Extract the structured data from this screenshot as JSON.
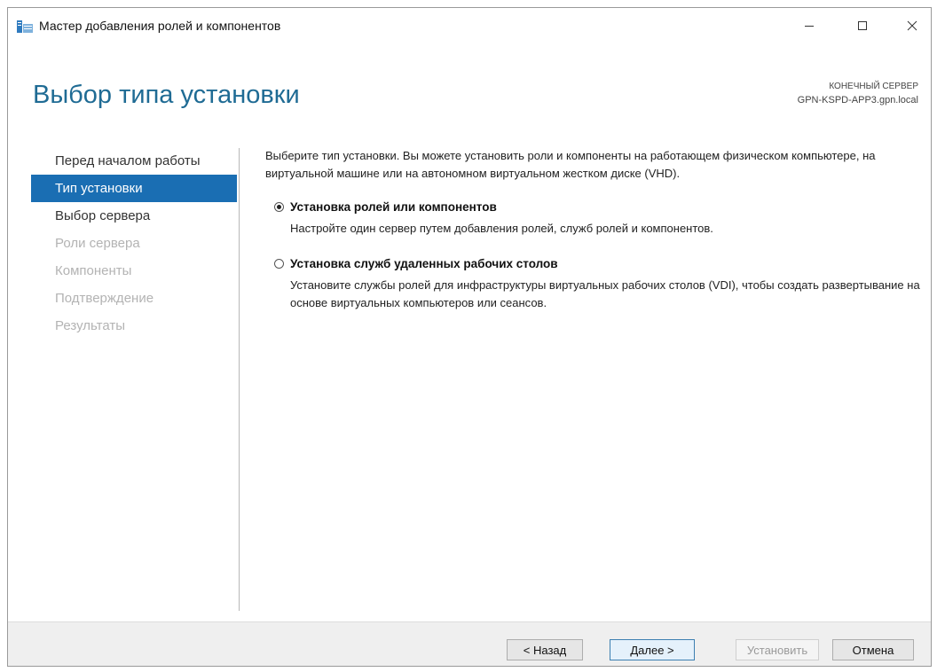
{
  "window": {
    "title": "Мастер добавления ролей и компонентов"
  },
  "header": {
    "page_title": "Выбор типа установки",
    "destination_label": "КОНЕЧНЫЙ СЕРВЕР",
    "destination_server": "GPN-KSPD-APP3.gpn.local"
  },
  "nav": {
    "items": [
      {
        "label": "Перед началом работы",
        "state": "normal"
      },
      {
        "label": "Тип установки",
        "state": "active"
      },
      {
        "label": "Выбор сервера",
        "state": "normal"
      },
      {
        "label": "Роли сервера",
        "state": "disabled"
      },
      {
        "label": "Компоненты",
        "state": "disabled"
      },
      {
        "label": "Подтверждение",
        "state": "disabled"
      },
      {
        "label": "Результаты",
        "state": "disabled"
      }
    ]
  },
  "content": {
    "intro": "Выберите тип установки. Вы можете установить роли и компоненты на работающем физическом компьютере, на виртуальной машине или на автономном виртуальном жестком диске (VHD).",
    "options": [
      {
        "title": "Установка ролей или компонентов",
        "description": "Настройте один сервер путем добавления ролей, служб ролей и компонентов.",
        "selected": true
      },
      {
        "title": "Установка служб удаленных рабочих столов",
        "description": "Установите службы ролей для инфраструктуры виртуальных рабочих столов (VDI), чтобы создать развертывание на основе виртуальных компьютеров или сеансов.",
        "selected": false
      }
    ]
  },
  "footer": {
    "back_label": "< Назад",
    "next_label": "Далее >",
    "install_label": "Установить",
    "cancel_label": "Отмена"
  },
  "colors": {
    "accent": "#1a6eb3",
    "title": "#1f6b94",
    "disabled_text": "#b3b3b3"
  },
  "icons": {
    "app": "server-manager-icon",
    "minimize": "minimize-icon",
    "maximize": "maximize-icon",
    "close": "close-icon"
  }
}
